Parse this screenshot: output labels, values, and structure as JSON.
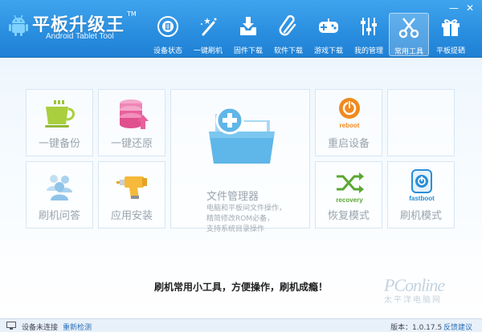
{
  "header": {
    "title": "平板升级王",
    "tm": "TM",
    "subtitle": "Android Tablet Tool"
  },
  "window_controls": {
    "minimize": "—",
    "close": "✕"
  },
  "nav": {
    "items": [
      {
        "label": "设备状态",
        "icon": "device-status-icon"
      },
      {
        "label": "一键刷机",
        "icon": "magic-wand-icon"
      },
      {
        "label": "固件下载",
        "icon": "firmware-download-icon"
      },
      {
        "label": "软件下载",
        "icon": "paperclip-icon"
      },
      {
        "label": "游戏下载",
        "icon": "gamepad-icon"
      },
      {
        "label": "我的管理",
        "icon": "sliders-icon"
      },
      {
        "label": "常用工具",
        "icon": "scissors-icon",
        "active": true
      },
      {
        "label": "平板提硒",
        "icon": "gift-icon"
      }
    ]
  },
  "tools": {
    "backup": {
      "label": "一键备份",
      "icon": "cup-backup-icon"
    },
    "restore": {
      "label": "一键还原",
      "icon": "database-restore-icon"
    },
    "file_manager": {
      "label": "文件管理器",
      "icon": "folder-add-icon",
      "desc_lines": [
        "电脑和平板间文件操作，",
        "精简修改ROM必备，",
        "支持系统目录操作"
      ]
    },
    "reboot": {
      "label": "重启设备",
      "icon": "reboot-icon",
      "badge": "reboot"
    },
    "flash_qa": {
      "label": "刷机问答",
      "icon": "users-icon"
    },
    "app_install": {
      "label": "应用安装",
      "icon": "drill-icon"
    },
    "recovery": {
      "label": "恢复模式",
      "icon": "recovery-icon",
      "badge": "recovery"
    },
    "fastboot": {
      "label": "刷机模式",
      "icon": "fastboot-icon",
      "badge": "fastboot"
    }
  },
  "tagline": "刷机常用小工具，方便操作，刷机成瘾！",
  "watermark": {
    "main": "PConline",
    "sub": "太平洋电脑网"
  },
  "status": {
    "device": "设备未连接",
    "recheck": "重新检测",
    "version": "版本：1.0.17.5",
    "feedback": "反馈建议"
  },
  "colors": {
    "header_blue": "#2b8fe0",
    "cup_green": "#9cc43a",
    "db_pink": "#e85a9a",
    "folder_blue": "#5fb6e8",
    "reboot_orange": "#f08a1e",
    "recovery_green": "#5aa832",
    "fastboot_blue": "#2a8ed6"
  }
}
